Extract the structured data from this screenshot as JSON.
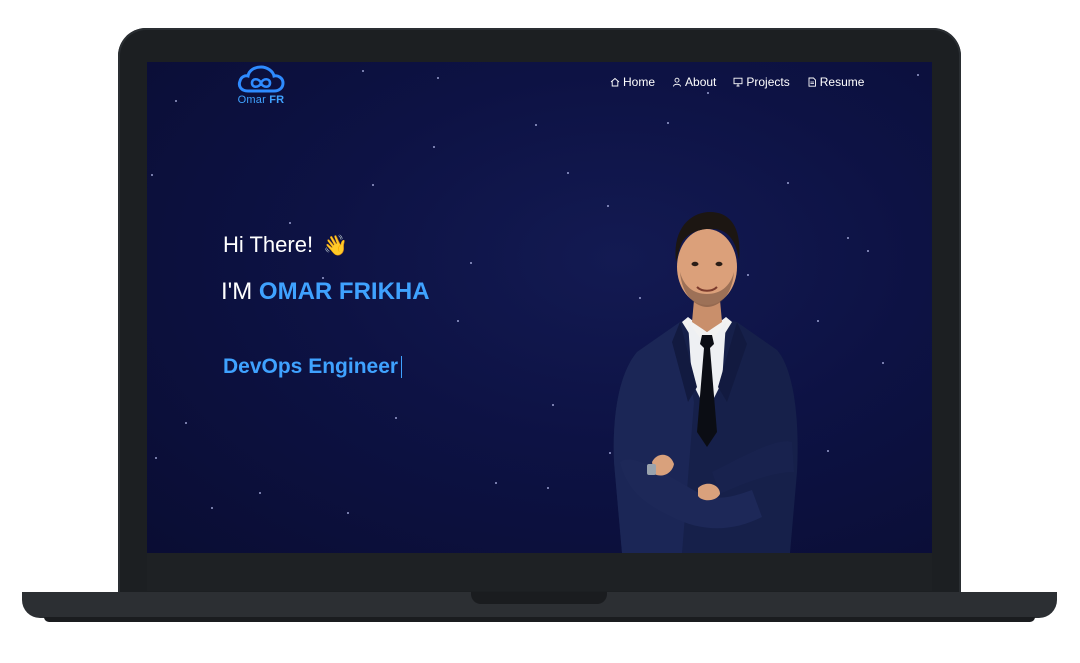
{
  "logo": {
    "name": "Omar",
    "suffix": "FR"
  },
  "nav": {
    "home": "Home",
    "about": "About",
    "projects": "Projects",
    "resume": "Resume"
  },
  "hero": {
    "greeting": "Hi There!",
    "wave_icon": "👋",
    "intro_prefix": "I'M",
    "name": "OMAR FRIKHA",
    "role": "DevOps Engineer"
  },
  "colors": {
    "accent": "#3fa2ff",
    "background": "#0d1244",
    "text": "#ffffff",
    "laptop_frame": "#1c1f22"
  }
}
